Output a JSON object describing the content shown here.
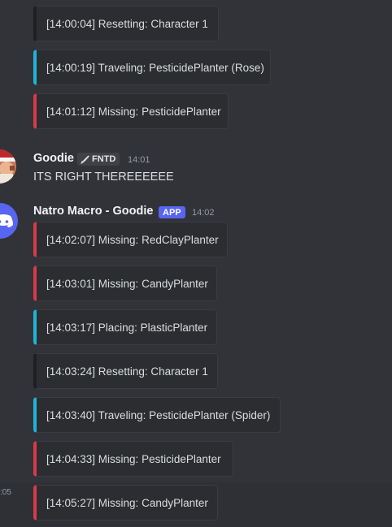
{
  "messages_top": [
    {
      "text": "[14:00:04] Resetting: Character 1",
      "accent": "dark"
    },
    {
      "text": "[14:00:19] Traveling: PesticidePlanter (Rose)",
      "accent": "cyan"
    },
    {
      "text": "[14:01:12] Missing: PesticidePlanter",
      "accent": "red"
    }
  ],
  "goodie_message": {
    "username": "Goodie",
    "badge": "FNTD",
    "timestamp": "14:01",
    "text": "ITS RIGHT THEREEEEEE"
  },
  "bot_message": {
    "username": "Natro Macro - Goodie",
    "badge": "APP",
    "timestamp": "14:02",
    "embeds": [
      {
        "text": "[14:02:07] Missing: RedClayPlanter",
        "accent": "red"
      },
      {
        "text": "[14:03:01] Missing: CandyPlanter",
        "accent": "red"
      },
      {
        "text": "[14:03:17] Placing: PlasticPlanter",
        "accent": "cyan"
      },
      {
        "text": "[14:03:24] Resetting: Character 1",
        "accent": "dark"
      },
      {
        "text": "[14:03:40] Traveling: PesticidePlanter (Spider)",
        "accent": "cyan"
      },
      {
        "text": "[14:04:33] Missing: PesticidePlanter",
        "accent": "red"
      }
    ]
  },
  "hover_message": {
    "gutter_time": ":05",
    "text": "[14:05:27] Missing: CandyPlanter",
    "accent": "red"
  },
  "colors": {
    "background": "#323339",
    "embed_background": "#2b2d31",
    "accent_red": "#d93a4b",
    "accent_cyan": "#1fb3d9",
    "app_badge": "#5865f2"
  }
}
